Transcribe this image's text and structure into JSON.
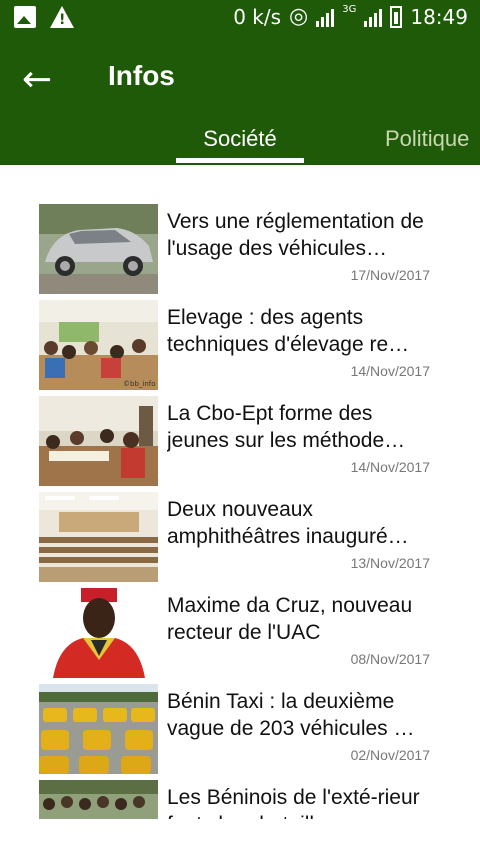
{
  "status_bar": {
    "speed": "0 k/s",
    "network_label": "3G",
    "time": "18:49"
  },
  "app_bar": {
    "back_icon": "arrow-left-icon",
    "title": "Infos"
  },
  "tabs": [
    {
      "label": "Société",
      "selected": true
    },
    {
      "label": "Politique",
      "selected": false
    }
  ],
  "articles": [
    {
      "title": "Vers une réglementation de l'usage des véhicules…",
      "date": "17/Nov/2017"
    },
    {
      "title": "Elevage : des agents techniques d'élevage re…",
      "date": "14/Nov/2017",
      "watermark": "©bb_info"
    },
    {
      "title": "La Cbo-Ept forme des jeunes sur les méthode…",
      "date": "14/Nov/2017"
    },
    {
      "title": "Deux nouveaux amphithéâtres inauguré…",
      "date": "13/Nov/2017"
    },
    {
      "title": "Maxime da Cruz, nouveau recteur de l'UAC",
      "date": "08/Nov/2017"
    },
    {
      "title": "Bénin Taxi : la deuxième vague de 203 véhicules …",
      "date": "02/Nov/2017"
    },
    {
      "title": "Les Béninois de l'exté-rieur fonts leur bataille",
      "date": ""
    }
  ],
  "colors": {
    "primary": "#1e5a08",
    "background": "#ffffff"
  }
}
